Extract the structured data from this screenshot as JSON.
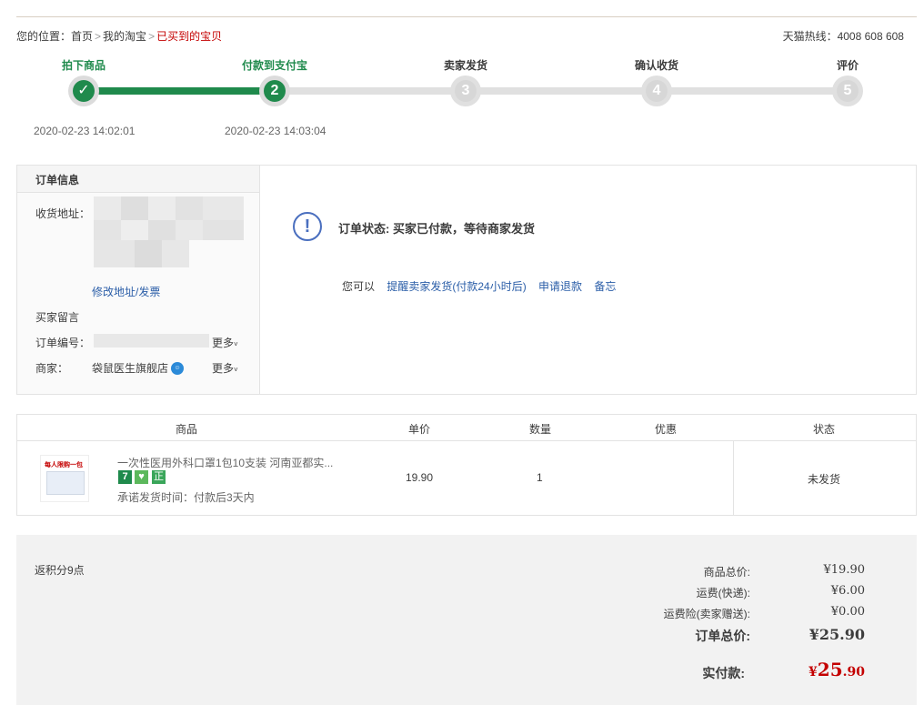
{
  "breadcrumb": {
    "prefix": "您的位置：",
    "items": [
      "首页",
      "我的淘宝",
      "已买到的宝贝"
    ],
    "sep": ">"
  },
  "hotline": "天猫热线：4008 608 608",
  "steps": [
    {
      "label": "拍下商品",
      "num": "✓",
      "time": "2020-02-23 14:02:01",
      "state": "done"
    },
    {
      "label": "付款到支付宝",
      "num": "2",
      "time": "2020-02-23 14:03:04",
      "state": "current"
    },
    {
      "label": "卖家发货",
      "num": "3",
      "time": "",
      "state": "pending"
    },
    {
      "label": "确认收货",
      "num": "4",
      "time": "",
      "state": "pending"
    },
    {
      "label": "评价",
      "num": "5",
      "time": "",
      "state": "pending"
    }
  ],
  "order_info": {
    "title": "订单信息",
    "address_label": "收货地址：",
    "edit_link": "修改地址/发票",
    "message_label": "买家留言",
    "order_no_label": "订单编号：",
    "more": "更多",
    "shop_label": "商家：",
    "shop_name": "袋鼠医生旗舰店"
  },
  "status": {
    "icon": "exclamation-icon",
    "text": "订单状态: 买家已付款，等待商家发货",
    "you_can": "您可以",
    "actions": [
      "提醒卖家发货(付款24小时后)",
      "申请退款",
      "备忘"
    ]
  },
  "table": {
    "headers": [
      "商品",
      "单价",
      "数量",
      "优惠",
      "状态"
    ],
    "item": {
      "thumb_text": "每人限购一包",
      "name": "一次性医用外科口罩1包10支装 河南亚都实...",
      "badges": [
        {
          "text": "7",
          "color": "#1f8a4c"
        },
        {
          "text": "♥",
          "color": "#5cb85c"
        },
        {
          "text": "正",
          "color": "#3aa65a"
        }
      ],
      "promise": "承诺发货时间：付款后3天内",
      "price": "19.90",
      "qty": "1",
      "discount": "",
      "status": "未发货"
    }
  },
  "summary": {
    "points": "返积分9点",
    "goods_total_label": "商品总价:",
    "goods_total": "¥19.90",
    "shipping_label": "运费(快递):",
    "shipping": "¥6.00",
    "insurance_label": "运费险(卖家赠送):",
    "insurance": "¥0.00",
    "order_total_label": "订单总价:",
    "order_total": "¥25.90",
    "paid_label": "实付款:",
    "paid_symbol": "¥",
    "paid_int": "25",
    "paid_dec": ".90"
  },
  "colors": {
    "accent_green": "#1f8a4c",
    "link_blue": "#2b5ea8",
    "price_red": "#c40000"
  }
}
